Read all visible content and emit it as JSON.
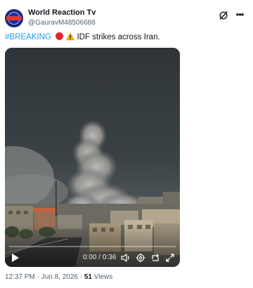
{
  "post": {
    "author": {
      "display_name": "World Reaction Tv",
      "handle": "@GauravM48506688",
      "avatar_icon": "news-globe-avatar"
    },
    "header_icons": [
      "grok-icon",
      "more-options-icon"
    ],
    "text": {
      "hashtag": "#BREAKING",
      "emoji": [
        "red-circle",
        "warning-sign"
      ],
      "body": "IDF strikes across Iran."
    },
    "media": {
      "type": "video",
      "time_display": "0:00 / 0:36",
      "progress": 0,
      "controls": [
        "play-icon",
        "volume-icon",
        "settings-icon",
        "loop-icon",
        "fullscreen-icon"
      ]
    },
    "meta": {
      "time": "12:37 PM",
      "separator": " · ",
      "date": "Jun 8, 2026",
      "views_count": "51",
      "views_label": "Views"
    },
    "colors": {
      "accent": "#1d9bf0",
      "text": "#0f1419",
      "secondary_text": "#536471",
      "red_circle": "#e3262c"
    }
  }
}
